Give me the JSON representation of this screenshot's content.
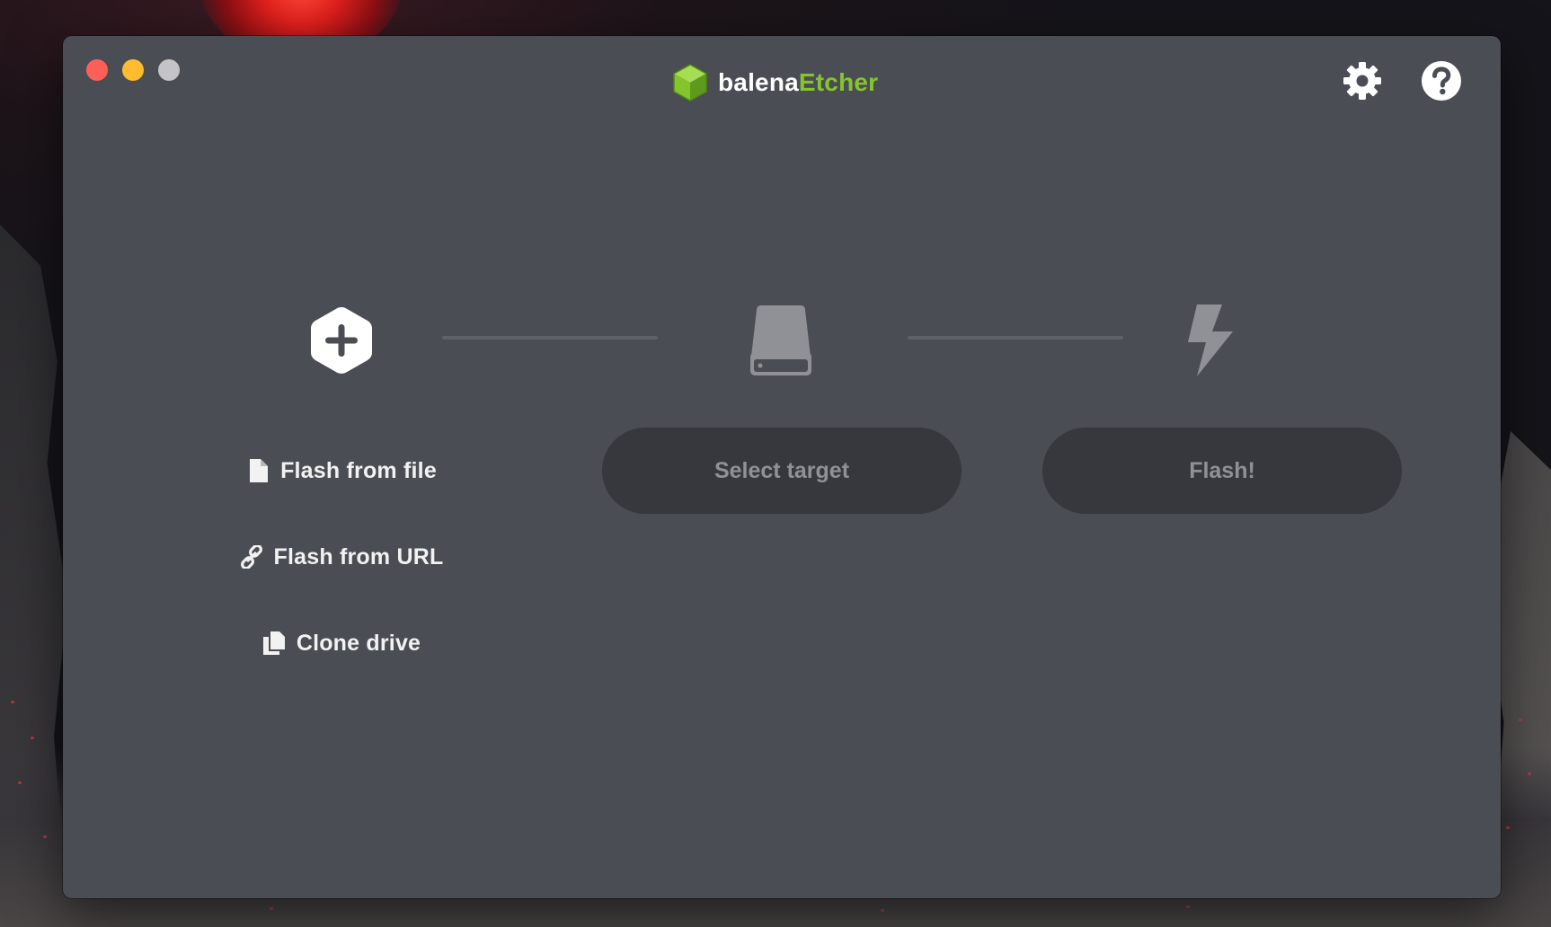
{
  "app": {
    "name_part1": "balena",
    "name_part2": "Etcher",
    "brand_color": "#85c52b",
    "background_color": "#4b4d55"
  },
  "window_controls": [
    {
      "name": "close",
      "color": "#fe5f57"
    },
    {
      "name": "minimize",
      "color": "#febc2e"
    },
    {
      "name": "zoom",
      "color": "#c4c4c6"
    }
  ],
  "header": {
    "settings_icon": "gear-icon",
    "help_icon": "question-circle-icon"
  },
  "steps": {
    "source": {
      "icon": "hexagon-plus-icon",
      "options": [
        {
          "label": "Flash from file",
          "icon": "file-icon"
        },
        {
          "label": "Flash from URL",
          "icon": "link-icon"
        },
        {
          "label": "Clone drive",
          "icon": "copy-icon"
        }
      ]
    },
    "target": {
      "icon": "drive-icon",
      "button_label": "Select target"
    },
    "flash": {
      "icon": "lightning-icon",
      "button_label": "Flash!"
    }
  }
}
